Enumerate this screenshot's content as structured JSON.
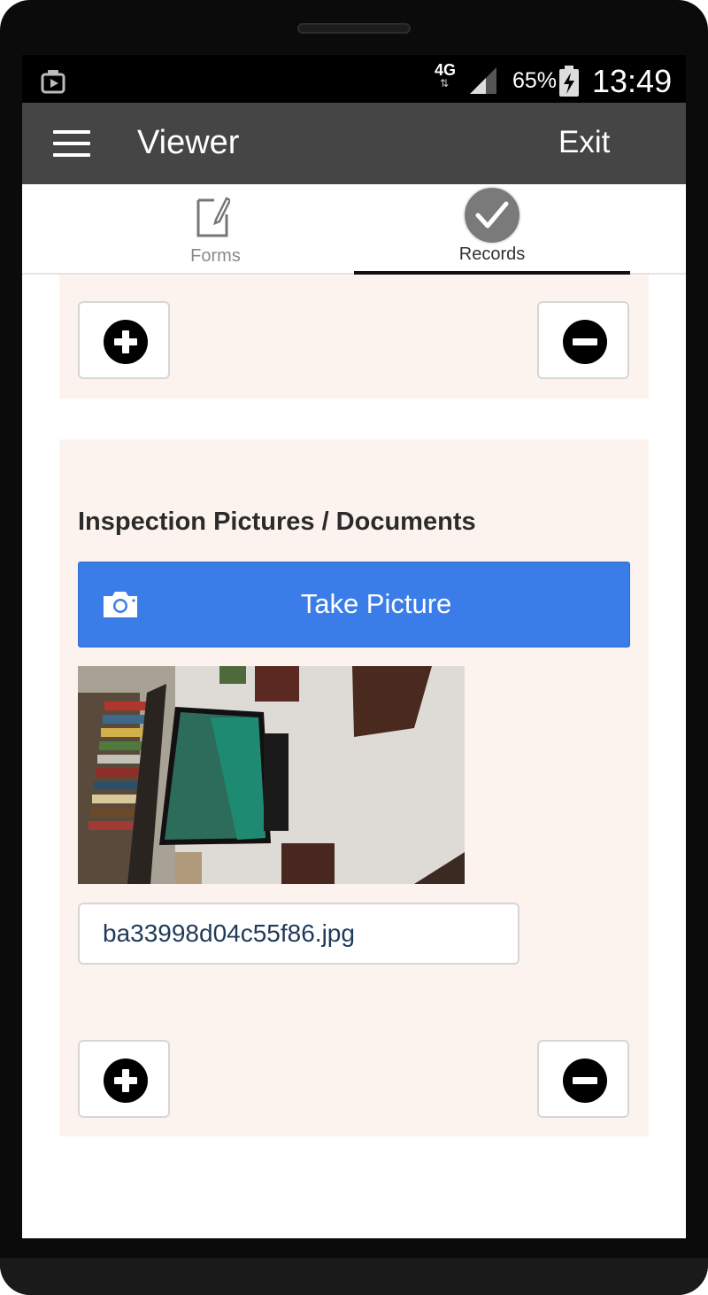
{
  "status_bar": {
    "network": "4G",
    "battery_percent": "65%",
    "time": "13:49"
  },
  "app_bar": {
    "title": "Viewer",
    "exit_label": "Exit",
    "menu_icon": "hamburger-menu-icon"
  },
  "tabs": [
    {
      "label": "Forms",
      "icon": "edit-form-icon",
      "active": false
    },
    {
      "label": "Records",
      "icon": "checkmark-icon",
      "active": true
    }
  ],
  "form": {
    "field_label": "Inspection Pictures / Documents",
    "take_picture_label": "Take Picture",
    "camera_icon": "camera-icon",
    "filename_value": "ba33998d04c55f86.jpg"
  },
  "colors": {
    "app_bar": "#454545",
    "section_background": "#fdf3ee",
    "primary_button": "#3b7de8"
  }
}
